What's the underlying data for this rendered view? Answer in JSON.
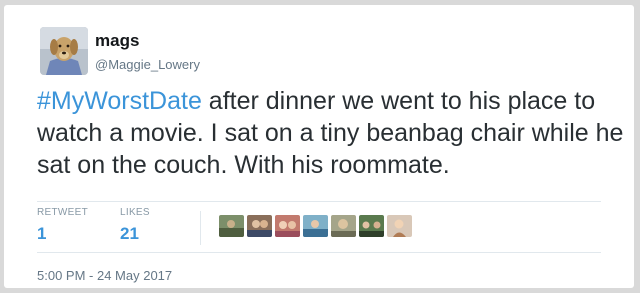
{
  "author": {
    "display_name": "mags",
    "handle": "@Maggie_Lowery"
  },
  "tweet": {
    "hashtag": "#MyWorstDate",
    "text": " after dinner we went to his place to watch a movie. I sat on a tiny beanbag chair while he sat on the couch. With his roommate."
  },
  "stats": {
    "retweets_label": "RETWEET",
    "retweets_count": "1",
    "likes_label": "LIKES",
    "likes_count": "21"
  },
  "timestamp": "5:00 PM - 24 May 2017",
  "colors": {
    "link": "#3b94d9",
    "text": "#292f33",
    "muted": "#657786",
    "divider": "#e1e8ed"
  }
}
